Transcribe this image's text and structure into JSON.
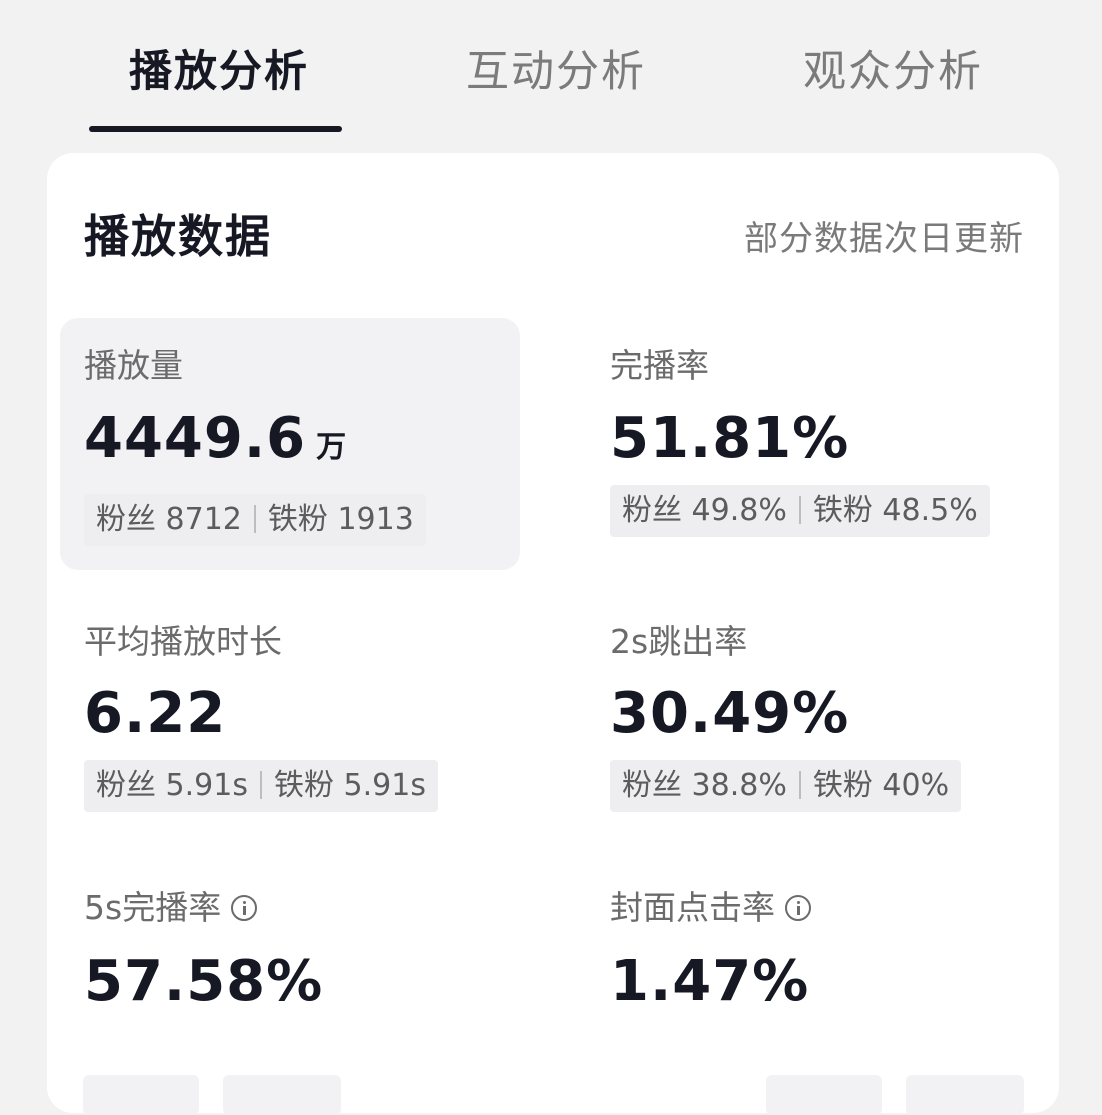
{
  "tabs": [
    {
      "label": "播放分析",
      "active": true
    },
    {
      "label": "互动分析",
      "active": false
    },
    {
      "label": "观众分析",
      "active": false
    }
  ],
  "card": {
    "title": "播放数据",
    "note": "部分数据次日更新"
  },
  "metrics": {
    "plays": {
      "label": "播放量",
      "value": "4449.6",
      "unit": "万",
      "fans_label": "粉丝",
      "fans": "8712",
      "iron_label": "铁粉",
      "iron": "1913"
    },
    "completion": {
      "label": "完播率",
      "value": "51.81%",
      "fans_label": "粉丝",
      "fans": "49.8%",
      "iron_label": "铁粉",
      "iron": "48.5%"
    },
    "avg_duration": {
      "label": "平均播放时长",
      "value": "6.22",
      "fans_label": "粉丝",
      "fans": "5.91s",
      "iron_label": "铁粉",
      "iron": "5.91s"
    },
    "bounce_2s": {
      "label": "2s跳出率",
      "value": "30.49%",
      "fans_label": "粉丝",
      "fans": "38.8%",
      "iron_label": "铁粉",
      "iron": "40%"
    },
    "completion_5s": {
      "label": "5s完播率",
      "value": "57.58%"
    },
    "cover_ctr": {
      "label": "封面点击率",
      "value": "1.47%"
    }
  },
  "colors": {
    "background": "#f2f2f2",
    "card": "#ffffff",
    "text": "#161823",
    "muted": "#7b7b7b",
    "chip": "#eeeef0"
  }
}
